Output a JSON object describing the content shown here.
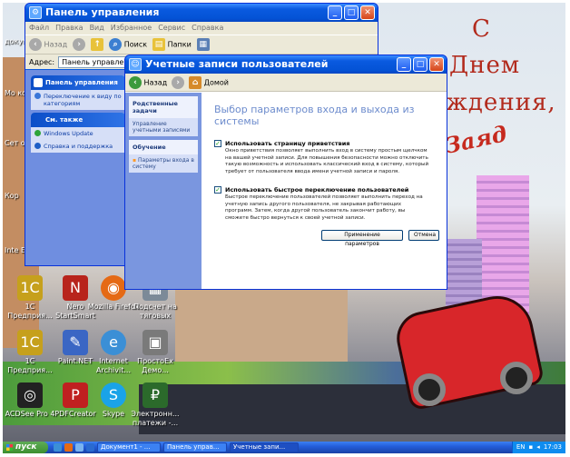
{
  "desktop": {
    "greeting_lines": [
      "С",
      "Днем",
      "ждения,"
    ],
    "signature": "Заяд",
    "icons": [
      {
        "label": "1С Предприя...",
        "icon": "1c-icon",
        "color": "#c6a01c"
      },
      {
        "label": "Nero StartSmart",
        "icon": "nero-icon",
        "color": "#b8241c"
      },
      {
        "label": "Mozilla Firefox",
        "icon": "firefox-icon",
        "color": "#e56a15"
      },
      {
        "label": "Подсчет на тяговых",
        "icon": "calc-icon",
        "color": "#7c8a98"
      },
      {
        "label": "1С Предприя...",
        "icon": "1c-icon",
        "color": "#c6a01c"
      },
      {
        "label": "Paint.NET",
        "icon": "paintnet-icon",
        "color": "#3a66c4"
      },
      {
        "label": "Internet Archivit...",
        "icon": "internet-icon",
        "color": "#3b8fd6"
      },
      {
        "label": "ПростоЕх Демо...",
        "icon": "demo-icon",
        "color": "#7a7a7a"
      },
      {
        "label": "ACDSee Pro 4",
        "icon": "acdsee-icon",
        "color": "#222"
      },
      {
        "label": "PDFCreator",
        "icon": "pdfcreator-icon",
        "color": "#c02020"
      },
      {
        "label": "Skype",
        "icon": "skype-icon",
        "color": "#1aa3e8"
      },
      {
        "label": "Электронн... платежи -...",
        "icon": "payment-icon",
        "color": "#2b6a2b"
      }
    ],
    "left_labels": [
      "докум",
      "Мо комп",
      "Сет окруж",
      "Кор",
      "Inte Explo"
    ]
  },
  "control_panel": {
    "title": "Панель управления",
    "menu": [
      "Файл",
      "Правка",
      "Вид",
      "Избранное",
      "Сервис",
      "Справка"
    ],
    "toolbar": {
      "back": "Назад",
      "search": "Поиск",
      "folders": "Папки"
    },
    "address_label": "Адрес:",
    "address_value": "Панель управления",
    "panel_header": "Панель управления",
    "switch_view": "Переключение к виду по категориям",
    "see_also": "См. также",
    "see_also_items": [
      "Windows Update",
      "Справка и поддержка"
    ]
  },
  "user_accounts": {
    "title": "Учетные записи пользователей",
    "nav": {
      "back": "Назад",
      "home": "Домой"
    },
    "side": {
      "related_title": "Родственные задачи",
      "related_item": "Управление учетными записями",
      "learn_title": "Обучение",
      "learn_item": "Параметры входа в систему"
    },
    "heading": "Выбор параметров входа и выхода из системы",
    "option1_label": "Использовать страницу приветствия",
    "option1_desc": "Окно приветствия позволяет выполнить вход в систему простым щелчком на вашей учетной записи. Для повышения безопасности можно отключить такую возможность и использовать классический вход в систему, который требует от пользователя ввода имени учетной записи и пароля.",
    "option2_label": "Использовать быстрое переключение пользователей",
    "option2_desc": "Быстрое переключение пользователей позволяет выполнить переход на учетную запись другого пользователя, не закрывая работающих программ. Затем, когда другой пользователь закончит работу, вы сможете быстро вернуться к своей учетной записи.",
    "apply": "Применение параметров",
    "cancel": "Отмена"
  },
  "taskbar": {
    "start": "пуск",
    "tasks": [
      "Документ1 - ...",
      "Панель управ...",
      "Учетные запи..."
    ],
    "lang": "EN",
    "clock": "17:03"
  }
}
